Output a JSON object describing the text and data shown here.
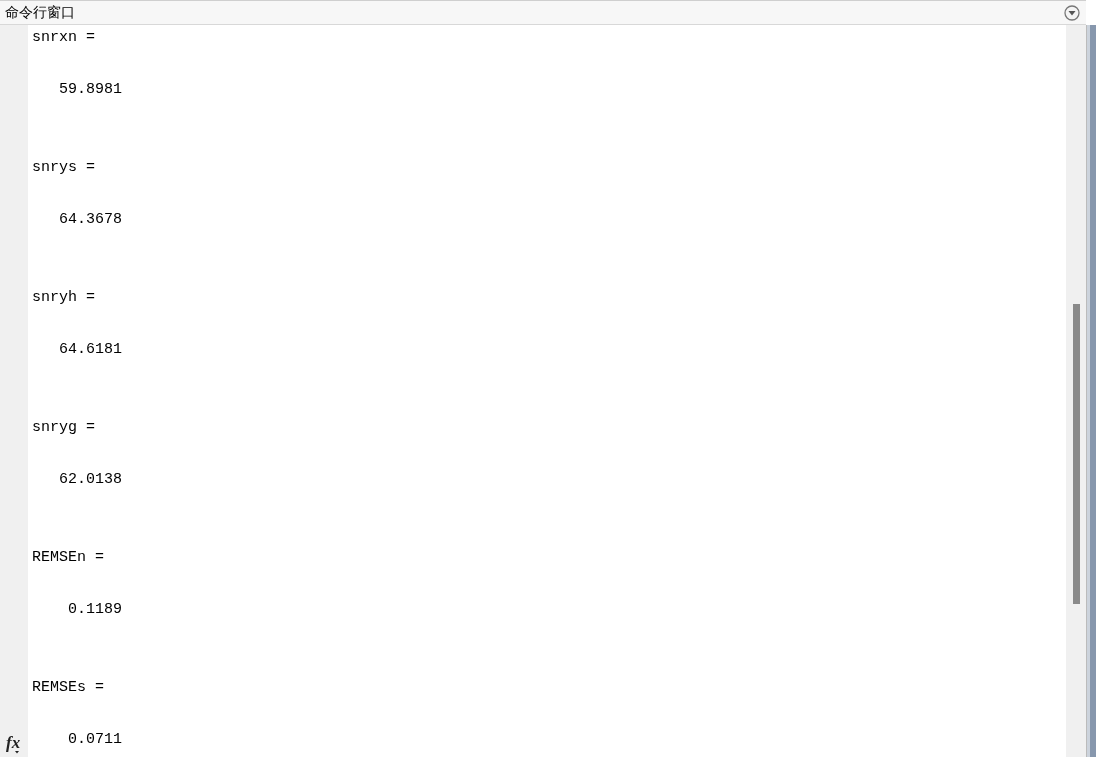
{
  "window": {
    "title": "命令行窗口"
  },
  "function_button": {
    "label": "fx"
  },
  "outputs": [
    {
      "name": "snrxn =",
      "value": "59.8981"
    },
    {
      "name": "snrys =",
      "value": "64.3678"
    },
    {
      "name": "snryh =",
      "value": "64.6181"
    },
    {
      "name": "snryg =",
      "value": "62.0138"
    },
    {
      "name": "REMSEn =",
      "value": "0.1189"
    },
    {
      "name": "REMSEs =",
      "value": "0.0711"
    }
  ]
}
